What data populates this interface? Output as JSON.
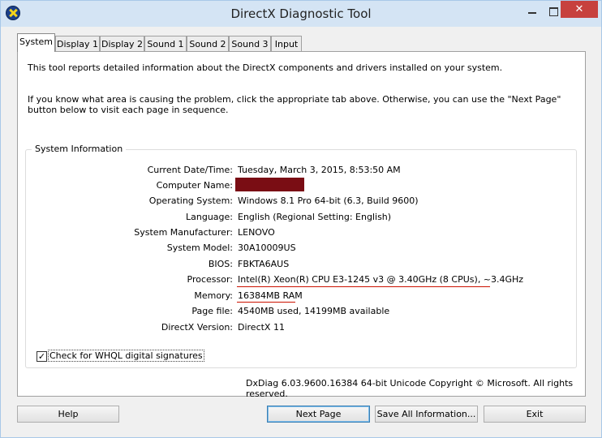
{
  "window": {
    "title": "DirectX Diagnostic Tool",
    "close_glyph": "✕"
  },
  "tabs": [
    {
      "label": "System"
    },
    {
      "label": "Display 1"
    },
    {
      "label": "Display 2"
    },
    {
      "label": "Sound 1"
    },
    {
      "label": "Sound 2"
    },
    {
      "label": "Sound 3"
    },
    {
      "label": "Input"
    }
  ],
  "intro": {
    "line1": "This tool reports detailed information about the DirectX components and drivers installed on your system.",
    "line2": "If you know what area is causing the problem, click the appropriate tab above.  Otherwise, you can use the \"Next Page\" button below to visit each page in sequence."
  },
  "system_info": {
    "group_label": "System Information",
    "rows": [
      {
        "label": "Current Date/Time:",
        "value": "Tuesday, March 3, 2015, 8:53:50 AM"
      },
      {
        "label": "Computer Name:",
        "value": ""
      },
      {
        "label": "Operating System:",
        "value": "Windows 8.1 Pro 64-bit (6.3, Build 9600)"
      },
      {
        "label": "Language:",
        "value": "English (Regional Setting: English)"
      },
      {
        "label": "System Manufacturer:",
        "value": "LENOVO"
      },
      {
        "label": "System Model:",
        "value": "30A10009US"
      },
      {
        "label": "BIOS:",
        "value": "FBKTA6AUS"
      },
      {
        "label": "Processor:",
        "value": "Intel(R) Xeon(R) CPU E3-1245 v3 @ 3.40GHz (8 CPUs), ~3.4GHz"
      },
      {
        "label": "Memory:",
        "value": "16384MB RAM"
      },
      {
        "label": "Page file:",
        "value": "4540MB used, 14199MB available"
      },
      {
        "label": "DirectX Version:",
        "value": "DirectX 11"
      }
    ]
  },
  "whql": {
    "label": "Check for WHQL digital signatures",
    "checked": true,
    "check_glyph": "✓"
  },
  "footer": {
    "copyright": "DxDiag 6.03.9600.16384 64-bit Unicode  Copyright © Microsoft. All rights reserved."
  },
  "buttons": {
    "help": "Help",
    "next_page": "Next Page",
    "save_all": "Save All Information...",
    "exit": "Exit"
  },
  "colors": {
    "redaction": "#7a0d14",
    "underline": "#cc1100",
    "close_button": "#c7413e"
  }
}
